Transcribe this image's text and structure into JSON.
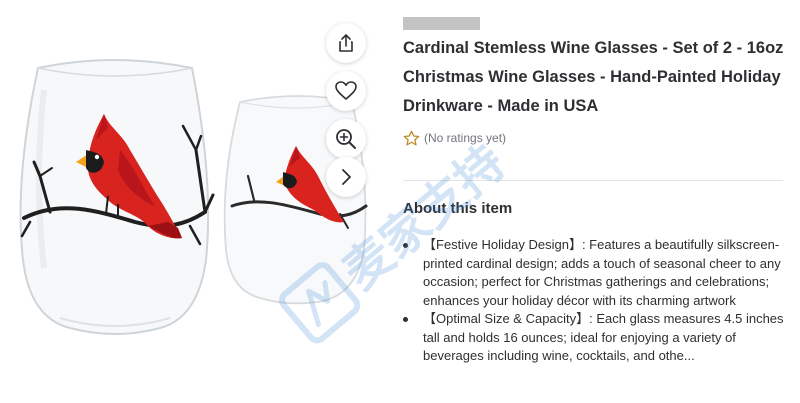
{
  "gallery": {
    "image_alt": "Cardinal stemless wine glasses",
    "actions": [
      {
        "name": "share",
        "icon": "share-icon"
      },
      {
        "name": "favorite",
        "icon": "heart-icon"
      },
      {
        "name": "zoom",
        "icon": "zoom-in-icon"
      },
      {
        "name": "next",
        "icon": "chevron-right-icon"
      }
    ]
  },
  "product": {
    "title": "Cardinal Stemless Wine Glasses - Set of 2 - 16oz Christmas Wine Glasses - Hand-Painted Holiday Drinkware - Made in USA",
    "rating_text": "(No ratings yet)",
    "rating_icon": "star-outline-icon"
  },
  "about": {
    "heading": "About this item",
    "bullets": [
      "【Festive Holiday Design】: Features a beautifully silkscreen-printed cardinal design; adds a touch of seasonal cheer to any occasion; perfect for Christmas gatherings and celebrations; enhances your holiday décor with its charming artwork",
      "【Optimal Size & Capacity】: Each glass measures 4.5 inches tall and holds 16 ounces; ideal for enjoying a variety of beverages including wine, cocktails, and othe..."
    ]
  },
  "watermark": {
    "text": "麦家支持"
  },
  "colors": {
    "text": "#2e2f32",
    "muted": "#74767c",
    "star": "#bb8a29",
    "cardinal_red": "#d8231f",
    "watermark_blue": "#3a86d9"
  }
}
